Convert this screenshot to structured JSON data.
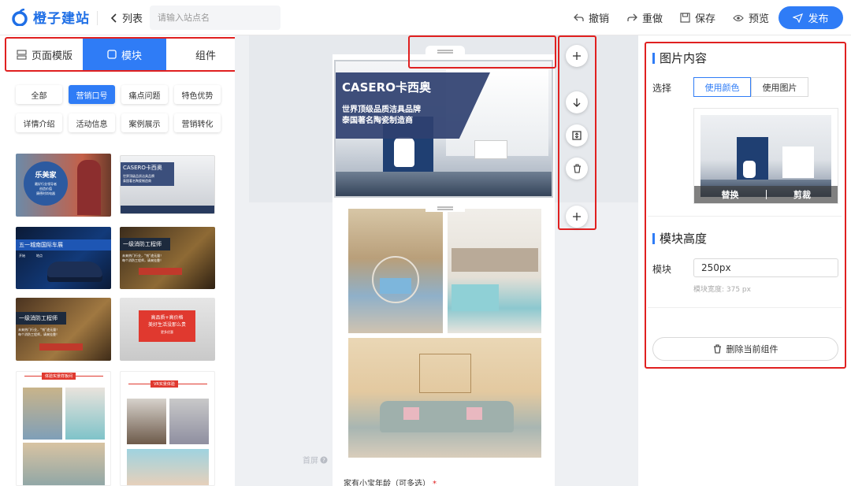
{
  "brand": {
    "name": "橙子建站",
    "accent": "#2f7cf6",
    "highlight": "#e02020"
  },
  "nav": {
    "back_label": "列表",
    "search_placeholder": "请输入站点名"
  },
  "toolbar": {
    "undo": "撤销",
    "redo": "重做",
    "save": "保存",
    "preview": "预览",
    "publish": "发布"
  },
  "left": {
    "tabs": [
      {
        "label": "页面模版",
        "icon": "page-template-icon",
        "active": false
      },
      {
        "label": "模块",
        "icon": "module-icon",
        "active": true
      },
      {
        "label": "组件",
        "icon": "",
        "active": false
      }
    ],
    "filters": [
      "全部",
      "营销口号",
      "痛点问题",
      "特色优势",
      "详情介绍",
      "活动信息",
      "案例展示",
      "营销转化"
    ],
    "active_filter": "营销口号",
    "thumbs": [
      {
        "title": "乐美家",
        "lines": [
          "最好行业领导者",
          "创造价值",
          "康德时尚电器"
        ]
      },
      {
        "title": "CASERO卡西奥",
        "lines": [
          "世界顶级品质洁具品牌",
          "泰国著名陶瓷制造商"
        ]
      },
      {
        "title": "五一城南国际车展",
        "lines": [
          "开始",
          "地点"
        ]
      },
      {
        "title": "一级消防工程师",
        "lines": [
          "未来热门行业，“钱”途无量！",
          "每个消防工程师，请来挂靠！"
        ]
      },
      {
        "title": "一级消防工程师",
        "lines": [
          "未来热门行业，“钱”途无量！",
          "每个消防工程师，请来挂靠！"
        ]
      },
      {
        "title": "高品质+高价格",
        "lines": [
          "美好生活没那么贵",
          "更多优惠"
        ]
      },
      {
        "title": "体验实景样板间",
        "lines": []
      },
      {
        "title": "VR实景体验",
        "lines": []
      }
    ]
  },
  "canvas": {
    "banner": {
      "title": "CASERO卡西奥",
      "line1": "世界顶级品质洁具品牌",
      "line2": "泰国著名陶瓷制造商"
    },
    "first_screen": "首屏",
    "form_label": "家有小宝年龄（可多选）",
    "required_mark": "*"
  },
  "right": {
    "image_section_title": "图片内容",
    "select_label": "选择",
    "seg_color": "使用颜色",
    "seg_image": "使用图片",
    "replace": "替换",
    "crop": "剪裁",
    "height_section_title": "模块高度",
    "height_label": "模块",
    "height_value": "250px",
    "width_hint": "模块宽度: 375 px",
    "delete_label": "删除当前组件"
  }
}
